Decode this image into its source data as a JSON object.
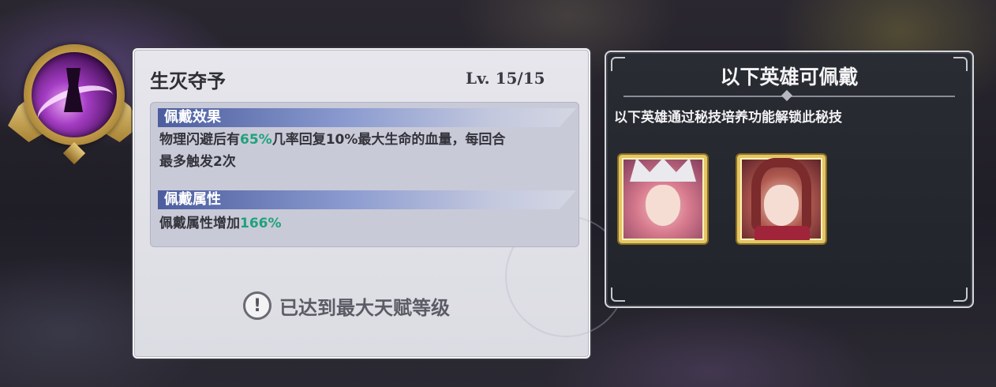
{
  "skill": {
    "name": "生灭夺予",
    "level": "Lv. 15/15",
    "icon": "skill-emblem-icon"
  },
  "effect": {
    "header": "佩戴效果",
    "line1_pre": "物理闪避后有",
    "line1_chance": "65%",
    "line1_post": "几率回复10%最大生命的血量，每回合",
    "line2": "最多触发2次"
  },
  "attribute": {
    "header": "佩戴属性",
    "text_pre": "佩戴属性增加",
    "value": "166%"
  },
  "max_message": {
    "icon": "!",
    "text": "已达到最大天赋等级"
  },
  "heroes_panel": {
    "title": "以下英雄可佩戴",
    "description": "以下英雄通过秘技培养功能解锁此秘技",
    "heroes": [
      "hero-portrait-1",
      "hero-portrait-2"
    ]
  },
  "colors": {
    "highlight": "#1fa27a",
    "frame_gold": "#e3c667",
    "section_blue": "#4b5d9e"
  }
}
